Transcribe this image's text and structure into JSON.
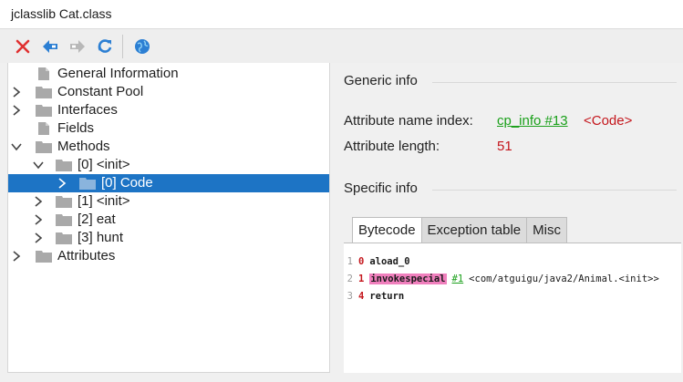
{
  "window": {
    "title": "jclasslib Cat.class"
  },
  "toolbar": {
    "buttons": [
      {
        "name": "close-file-button",
        "icon": "close-icon",
        "color": "#e03030"
      },
      {
        "name": "back-button",
        "icon": "arrow-left-icon",
        "color": "#2c7fd3"
      },
      {
        "name": "forward-button",
        "icon": "arrow-right-icon",
        "color": "#b8b8b8"
      },
      {
        "name": "reload-button",
        "icon": "refresh-icon",
        "color": "#2c7fd3"
      },
      {
        "name": "browser-button",
        "icon": "globe-icon",
        "color": "#2c7fd3"
      }
    ]
  },
  "tree": {
    "nodes": [
      {
        "label": "General Information",
        "icon": "file-icon",
        "chevron": "none"
      },
      {
        "label": "Constant Pool",
        "icon": "folder-icon",
        "chevron": "right"
      },
      {
        "label": "Interfaces",
        "icon": "folder-icon",
        "chevron": "right"
      },
      {
        "label": "Fields",
        "icon": "file-icon",
        "chevron": "none"
      },
      {
        "label": "Methods",
        "icon": "folder-icon",
        "chevron": "down"
      },
      {
        "label": "[0] <init>",
        "icon": "folder-icon",
        "chevron": "down"
      },
      {
        "label": "[0] Code",
        "icon": "folder-icon",
        "chevron": "right",
        "selected": true
      },
      {
        "label": "[1] <init>",
        "icon": "folder-icon",
        "chevron": "right"
      },
      {
        "label": "[2] eat",
        "icon": "folder-icon",
        "chevron": "right"
      },
      {
        "label": "[3] hunt",
        "icon": "folder-icon",
        "chevron": "right"
      },
      {
        "label": "Attributes",
        "icon": "folder-icon",
        "chevron": "right"
      }
    ]
  },
  "generic": {
    "title": "Generic info",
    "name_index_label": "Attribute name index:",
    "name_index_link": "cp_info #13",
    "name_index_value": "<Code>",
    "length_label": "Attribute length:",
    "length_value": "51"
  },
  "specific": {
    "title": "Specific info",
    "tabs": [
      "Bytecode",
      "Exception table",
      "Misc"
    ],
    "active_tab": "Bytecode"
  },
  "bytecode": [
    {
      "line": "1",
      "offset": "0",
      "opcode": "aload_0",
      "highlight": false,
      "ref": "",
      "comment": ""
    },
    {
      "line": "2",
      "offset": "1",
      "opcode": "invokespecial",
      "highlight": true,
      "ref": "#1",
      "comment": "<com/atguigu/java2/Animal.<init>>"
    },
    {
      "line": "3",
      "offset": "4",
      "opcode": "return",
      "highlight": false,
      "ref": "",
      "comment": ""
    }
  ],
  "colors": {
    "selection": "#1d74c5",
    "link": "#1aa01a",
    "value": "#c4161c",
    "highlight": "#f07fbd"
  }
}
